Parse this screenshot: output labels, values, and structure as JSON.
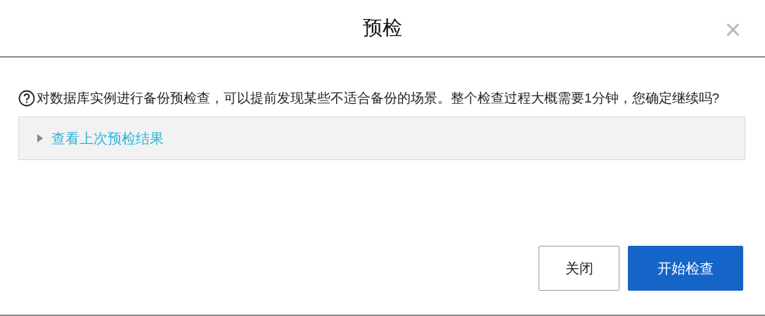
{
  "dialog": {
    "title": "预检",
    "close": "×"
  },
  "message": "对数据库实例进行备份预检查，可以提前发现某些不适合备份的场景。整个检查过程大概需要1分钟，您确定继续吗?",
  "collapse": {
    "label": "查看上次预检结果",
    "expanded": false
  },
  "buttons": [
    {
      "label": "关闭",
      "kind": "secondary"
    },
    {
      "label": "开始检查",
      "kind": "primary"
    }
  ]
}
